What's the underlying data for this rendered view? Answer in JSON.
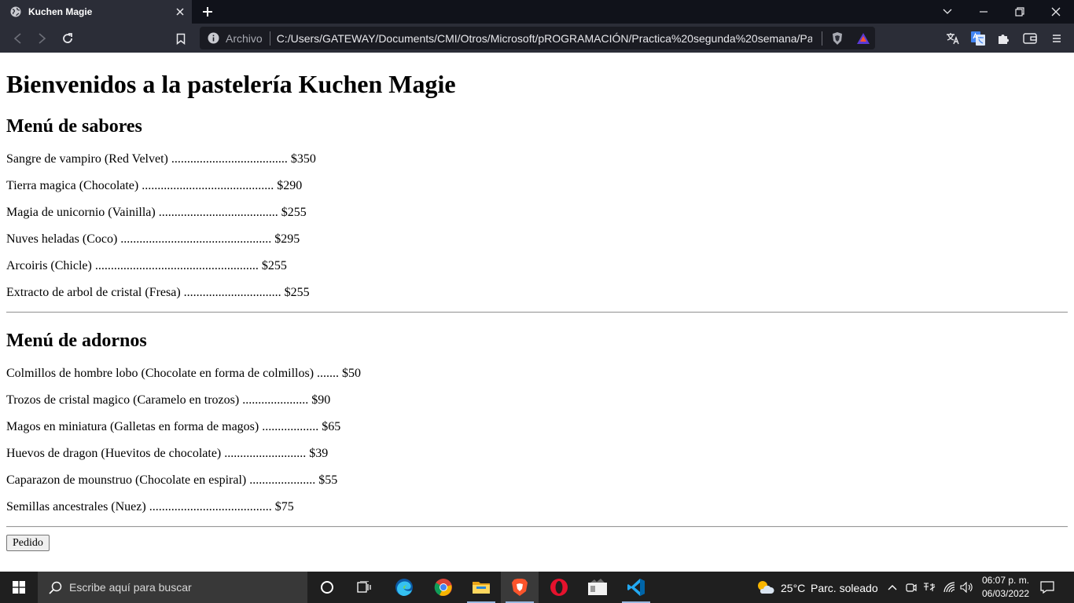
{
  "browser": {
    "tab_title": "Kuchen Magie",
    "address_scheme_label": "Archivo",
    "address_url": "C:/Users/GATEWAY/Documents/CMI/Otros/Microsoft/pROGRAMACIÓN/Practica%20segunda%20semana/Pa..."
  },
  "page": {
    "heading": "Bienvenidos a la pastelería Kuchen Magie",
    "sabores": {
      "title": "Menú de sabores",
      "items": [
        "Sangre de vampiro (Red Velvet) ..................................... $350",
        "Tierra magica (Chocolate) .......................................... $290",
        "Magia de unicornio (Vainilla) ...................................... $255",
        "Nuves heladas (Coco) ................................................ $295",
        "Arcoiris (Chicle) .................................................... $255",
        "Extracto de arbol de cristal (Fresa) ............................... $255"
      ]
    },
    "adornos": {
      "title": "Menú de adornos",
      "items": [
        "Colmillos de hombre lobo (Chocolate en forma de colmillos) ....... $50",
        "Trozos de cristal magico (Caramelo en trozos) ..................... $90",
        "Magos en miniatura (Galletas en forma de magos) .................. $65",
        "Huevos de dragon (Huevitos de chocolate) .......................... $39",
        "Caparazon de mounstruo (Chocolate en espiral) ..................... $55",
        "Semillas ancestrales (Nuez) ....................................... $75"
      ]
    },
    "order_button": "Pedido"
  },
  "taskbar": {
    "search_placeholder": "Escribe aquí para buscar",
    "weather_temp": "25°C",
    "weather_desc": "Parc. soleado",
    "time": "06:07 p. m.",
    "date": "06/03/2022",
    "apps": [
      "task-view",
      "edge",
      "chrome",
      "file-explorer",
      "brave",
      "opera",
      "app-window",
      "vscode"
    ]
  },
  "colors": {
    "tab_bar": "#10121a",
    "toolbar": "#2b2d37",
    "taskbar": "#1f1f1f",
    "brave_orange": "#fb542b",
    "vscode_blue": "#23a9f2"
  }
}
